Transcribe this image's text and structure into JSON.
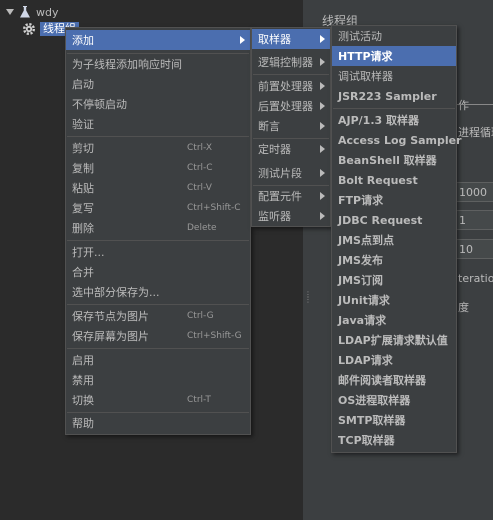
{
  "tree": {
    "root_label": "wdy",
    "child_label": "线程组"
  },
  "right_panel": {
    "title": "线程组",
    "partial_text_1": "作",
    "partial_text_2": "进程循环",
    "field_values": [
      "1000",
      "1",
      "10"
    ],
    "partial_text_3": "teration",
    "partial_text_4": "度"
  },
  "context_menu": {
    "items": [
      {
        "label": "添加",
        "shortcut": "",
        "submenu": true
      },
      {
        "label": "为子线程添加响应时间",
        "shortcut": ""
      },
      {
        "label": "启动",
        "shortcut": ""
      },
      {
        "label": "不停顿启动",
        "shortcut": ""
      },
      {
        "label": "验证",
        "shortcut": ""
      },
      {
        "label": "剪切",
        "shortcut": "Ctrl-X"
      },
      {
        "label": "复制",
        "shortcut": "Ctrl-C"
      },
      {
        "label": "粘贴",
        "shortcut": "Ctrl-V"
      },
      {
        "label": "复写",
        "shortcut": "Ctrl+Shift-C"
      },
      {
        "label": "删除",
        "shortcut": "Delete"
      },
      {
        "label": "打开...",
        "shortcut": ""
      },
      {
        "label": "合并",
        "shortcut": ""
      },
      {
        "label": "选中部分保存为...",
        "shortcut": ""
      },
      {
        "label": "保存节点为图片",
        "shortcut": "Ctrl-G"
      },
      {
        "label": "保存屏幕为图片",
        "shortcut": "Ctrl+Shift-G"
      },
      {
        "label": "启用",
        "shortcut": ""
      },
      {
        "label": "禁用",
        "shortcut": ""
      },
      {
        "label": "切换",
        "shortcut": "Ctrl-T"
      },
      {
        "label": "帮助",
        "shortcut": ""
      }
    ]
  },
  "add_submenu": {
    "items": [
      {
        "label": "取样器"
      },
      {
        "label": "逻辑控制器"
      },
      {
        "label": "前置处理器"
      },
      {
        "label": "后置处理器"
      },
      {
        "label": "断言"
      },
      {
        "label": "定时器"
      },
      {
        "label": "测试片段"
      },
      {
        "label": "配置元件"
      },
      {
        "label": "监听器"
      }
    ]
  },
  "sampler_submenu": {
    "items": [
      {
        "label": "测试活动"
      },
      {
        "label": "HTTP请求"
      },
      {
        "label": "调试取样器"
      },
      {
        "label": "JSR223 Sampler"
      },
      {
        "label": "AJP/1.3 取样器"
      },
      {
        "label": "Access Log Sampler"
      },
      {
        "label": "BeanShell 取样器"
      },
      {
        "label": "Bolt Request"
      },
      {
        "label": "FTP请求"
      },
      {
        "label": "JDBC Request"
      },
      {
        "label": "JMS点到点"
      },
      {
        "label": "JMS发布"
      },
      {
        "label": "JMS订阅"
      },
      {
        "label": "JUnit请求"
      },
      {
        "label": "Java请求"
      },
      {
        "label": "LDAP扩展请求默认值"
      },
      {
        "label": "LDAP请求"
      },
      {
        "label": "邮件阅读者取样器"
      },
      {
        "label": "OS进程取样器"
      },
      {
        "label": "SMTP取样器"
      },
      {
        "label": "TCP取样器"
      }
    ]
  },
  "colors": {
    "highlight": "#4b6eaf",
    "menu_bg": "#3c3f41",
    "tree_bg": "#2b2b2b"
  }
}
